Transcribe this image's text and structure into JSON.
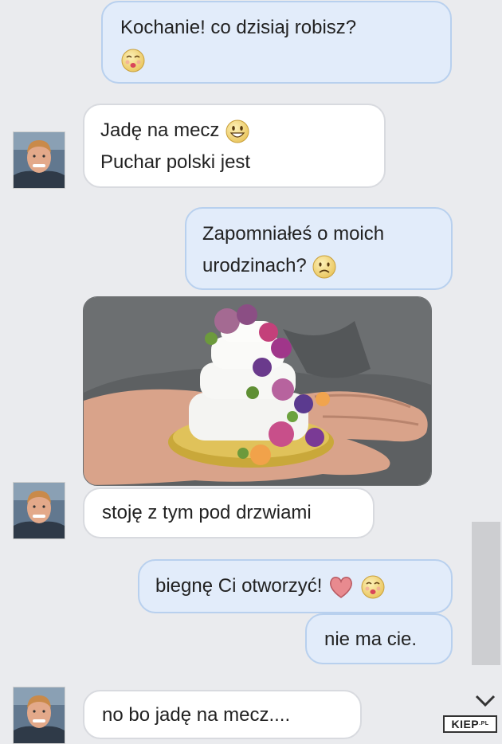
{
  "messages": {
    "m1": {
      "line1": "Kochanie! co dzisiaj robisz?"
    },
    "m2": {
      "line1": "Jadę na mecz",
      "line2": "Puchar polski jest"
    },
    "m3": {
      "line1": "Zapomniałeś o moich",
      "line2": "urodzinach?"
    },
    "m5": {
      "text": "stoję z tym pod drzwiami"
    },
    "m6": {
      "text": "biegnę Ci otworzyć!"
    },
    "m7": {
      "text": "nie ma cie."
    },
    "m8": {
      "text": "no bo jadę na mecz...."
    }
  },
  "watermark": {
    "brand": "KIEP",
    "suffix": ".PL"
  },
  "colors": {
    "outgoing_bubble": "#e2ecfa",
    "incoming_bubble": "#ffffff",
    "heart": "#e88a8f",
    "emoji": "#f6dd7a"
  }
}
